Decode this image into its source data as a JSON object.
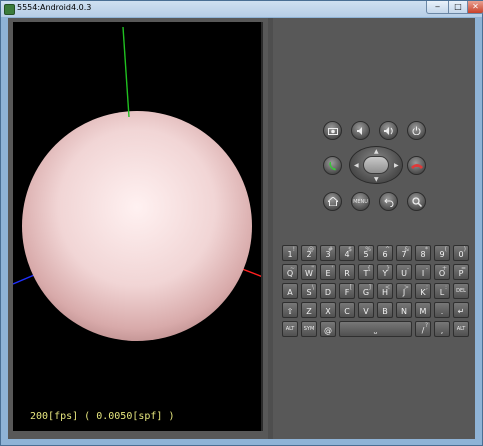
{
  "window": {
    "title": "5554:Android4.0.3",
    "min_glyph": "‒",
    "max_glyph": "□",
    "close_glyph": "✕"
  },
  "screen": {
    "fps_text": "200[fps] ( 0.0050[spf] )",
    "colors": {
      "background": "#000000",
      "sphere": "#f3d9d9",
      "axis_x": "#ff2020",
      "axis_y": "#20c020",
      "axis_z": "#2020ff",
      "fps_text": "#e6e67e"
    }
  },
  "controls": {
    "top_row": [
      "camera-icon",
      "volume-down-icon",
      "volume-up-icon",
      "power-icon"
    ],
    "call_button": "call-icon",
    "end_call_button": "end-call-icon",
    "bottom_row": [
      "home-icon",
      "menu-button",
      "back-icon",
      "search-icon"
    ],
    "menu_label": "MENU"
  },
  "keyboard": {
    "row1": [
      {
        "main": "1",
        "alt": "!"
      },
      {
        "main": "2",
        "alt": "@"
      },
      {
        "main": "3",
        "alt": "#"
      },
      {
        "main": "4",
        "alt": "$"
      },
      {
        "main": "5",
        "alt": "%"
      },
      {
        "main": "6",
        "alt": "^"
      },
      {
        "main": "7",
        "alt": "&"
      },
      {
        "main": "8",
        "alt": "*"
      },
      {
        "main": "9",
        "alt": "("
      },
      {
        "main": "0",
        "alt": ")"
      }
    ],
    "row2": [
      {
        "main": "Q",
        "alt": "~"
      },
      {
        "main": "W",
        "alt": "\""
      },
      {
        "main": "E",
        "alt": "'"
      },
      {
        "main": "R",
        "alt": ""
      },
      {
        "main": "T",
        "alt": "{"
      },
      {
        "main": "Y",
        "alt": "}"
      },
      {
        "main": "U",
        "alt": "-"
      },
      {
        "main": "I",
        "alt": "-"
      },
      {
        "main": "O",
        "alt": "+"
      },
      {
        "main": "P",
        "alt": "="
      }
    ],
    "row3": [
      {
        "main": "A",
        "alt": ""
      },
      {
        "main": "S",
        "alt": "\\"
      },
      {
        "main": "D",
        "alt": ""
      },
      {
        "main": "F",
        "alt": "["
      },
      {
        "main": "G",
        "alt": "]"
      },
      {
        "main": "H",
        "alt": "<"
      },
      {
        "main": "J",
        "alt": ">"
      },
      {
        "main": "K",
        "alt": ";"
      },
      {
        "main": "L",
        "alt": ":"
      },
      {
        "main": "DEL",
        "alt": ""
      }
    ],
    "row4": [
      {
        "main": "⇧",
        "alt": ""
      },
      {
        "main": "Z",
        "alt": ""
      },
      {
        "main": "X",
        "alt": ""
      },
      {
        "main": "C",
        "alt": ""
      },
      {
        "main": "V",
        "alt": ""
      },
      {
        "main": "B",
        "alt": ""
      },
      {
        "main": "N",
        "alt": ""
      },
      {
        "main": "M",
        "alt": ""
      },
      {
        "main": ".",
        "alt": ""
      },
      {
        "main": "↵",
        "alt": ""
      }
    ],
    "row5": {
      "alt_left": "ALT",
      "sym": "SYM",
      "at": "@",
      "space": "⎵",
      "slash": "/",
      "comma": ",",
      "question": "?",
      "alt_right": "ALT"
    }
  }
}
